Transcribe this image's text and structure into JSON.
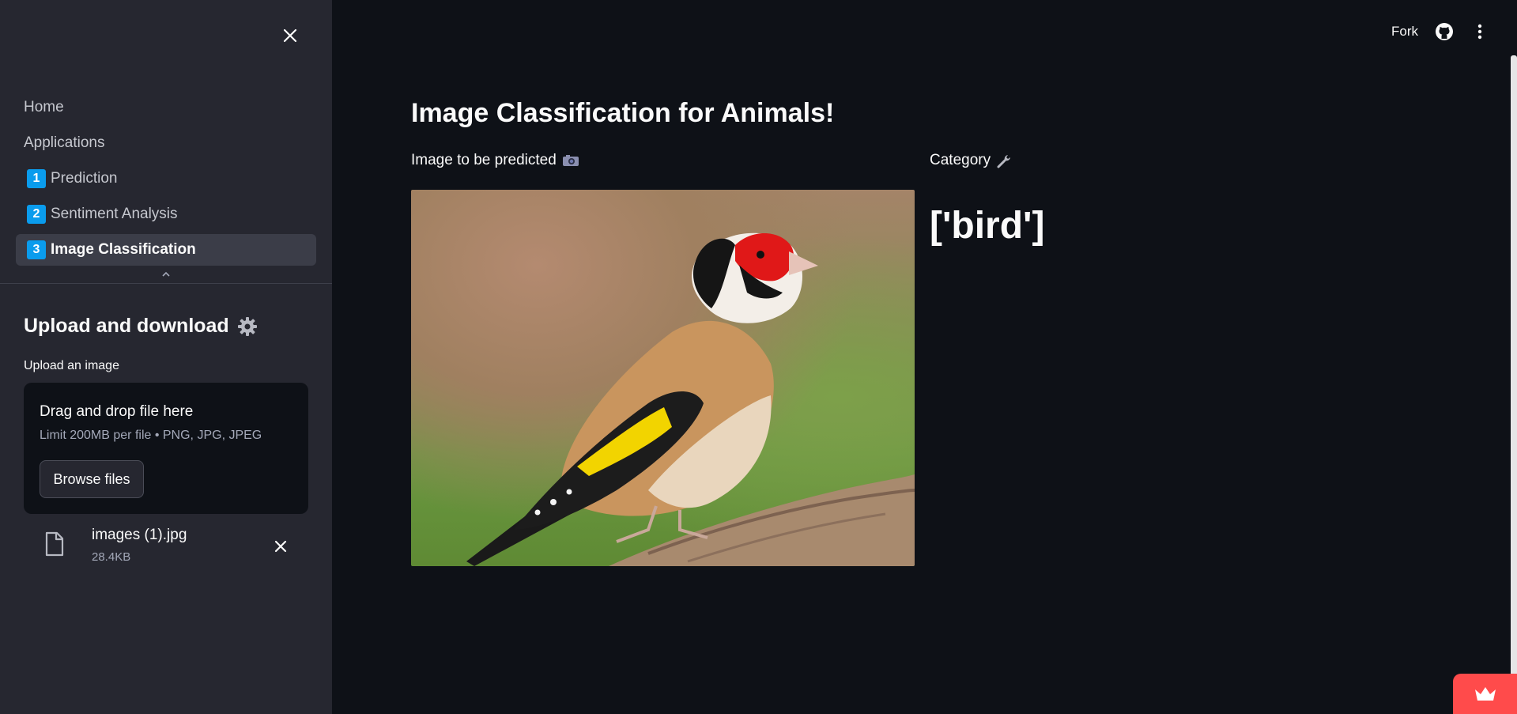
{
  "sidebar": {
    "nav": [
      {
        "label": "Home"
      },
      {
        "label": "Applications"
      },
      {
        "num": "1",
        "label": "Prediction"
      },
      {
        "num": "2",
        "label": "Sentiment Analysis"
      },
      {
        "num": "3",
        "label": "Image Classification",
        "active": true
      }
    ],
    "upload_title": "Upload and download",
    "upload_label": "Upload an image",
    "dropzone": {
      "main": "Drag and drop file here",
      "sub": "Limit 200MB per file • PNG, JPG, JPEG",
      "button": "Browse files"
    },
    "file": {
      "name": "images (1).jpg",
      "size": "28.4KB"
    }
  },
  "header": {
    "fork": "Fork",
    "github_icon": "github-icon",
    "menu_icon": "kebab-menu-icon"
  },
  "main": {
    "title": "Image Classification for Animals!",
    "left_label": "Image to be predicted",
    "left_icon": "camera-icon",
    "right_label": "Category",
    "right_icon": "wrench-icon",
    "result": "['bird']"
  },
  "colors": {
    "accent": "#0a9ced",
    "manage": "#ff4b4b",
    "bg": "#0e1117",
    "sidebar": "#262730"
  }
}
